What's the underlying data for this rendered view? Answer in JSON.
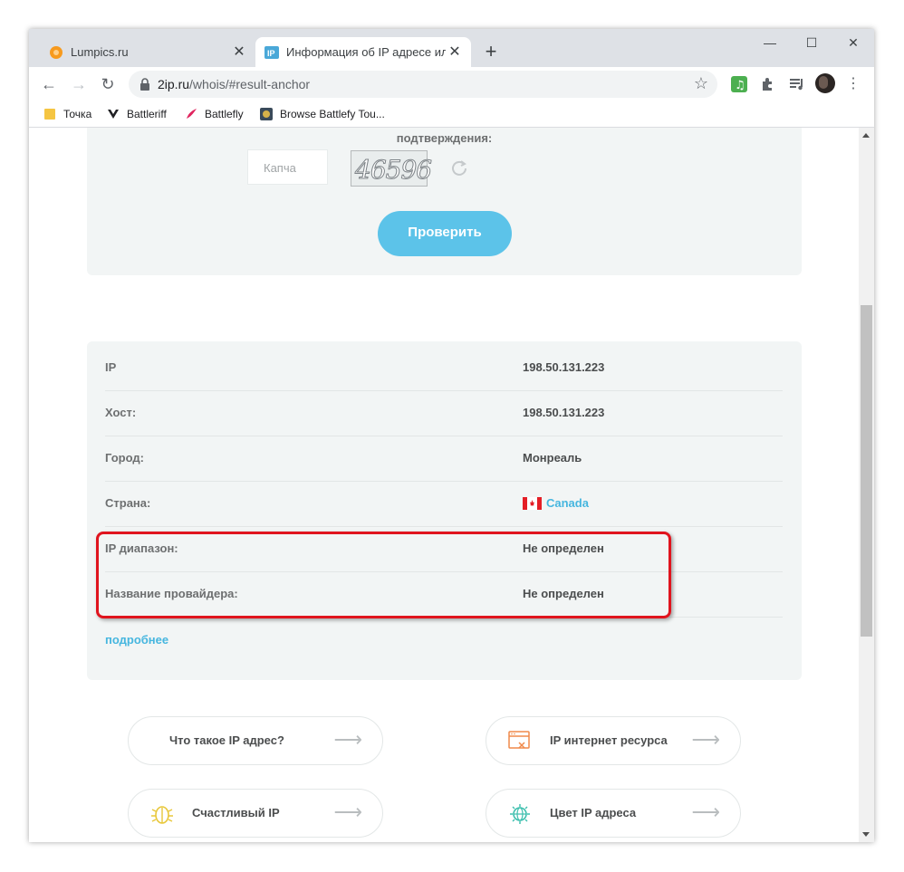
{
  "browser": {
    "tabs": [
      {
        "title": "Lumpics.ru",
        "active": false
      },
      {
        "title": "Информация об IP адресе или д",
        "active": true
      }
    ],
    "url_host": "2ip.ru",
    "url_path": "/whois/#result-anchor",
    "bookmarks": [
      "Точка",
      "Battleriff",
      "Battlefly",
      "Browse Battlefy Tou..."
    ]
  },
  "captcha": {
    "label": "подтверждения:",
    "input_placeholder": "Капча",
    "code": "46596",
    "submit_label": "Проверить"
  },
  "info": {
    "rows": [
      {
        "key": "IP",
        "value": "198.50.131.223"
      },
      {
        "key": "Хост:",
        "value": "198.50.131.223"
      },
      {
        "key": "Город:",
        "value": "Монреаль"
      },
      {
        "key": "Страна:",
        "value": "Canada"
      },
      {
        "key": "IP диапазон:",
        "value": "Не определен"
      },
      {
        "key": "Название провайдера:",
        "value": "Не определен"
      }
    ],
    "more_link": "подробнее"
  },
  "cards": [
    {
      "label": "Что такое IP адрес?"
    },
    {
      "label": "IP интернет ресурса"
    },
    {
      "label": "Счастливый IP"
    },
    {
      "label": "Цвет IP адреса"
    }
  ],
  "colors": {
    "accent": "#5cc3e9",
    "link": "#46b6df",
    "highlight": "#e0141e",
    "panel": "#f2f5f5"
  }
}
